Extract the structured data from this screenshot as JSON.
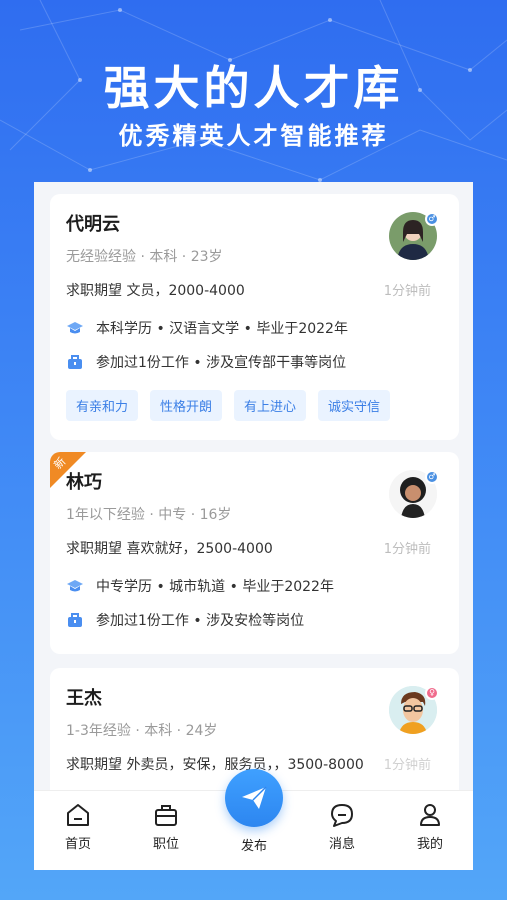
{
  "hero": {
    "title": "强大的人才库",
    "subtitle": "优秀精英人才智能推荐"
  },
  "colors": {
    "brand": "#2f6df0",
    "tag_bg": "#eaf3ff",
    "tag_text": "#3b7fe6",
    "new_badge": "#f08a24",
    "male": "#4a90e2",
    "female": "#f06b8c"
  },
  "candidates": [
    {
      "name": "代明云",
      "meta": "无经验经验 · 本科 · 23岁",
      "expect": "求职期望 文员，2000-4000",
      "time": "1分钟前",
      "education": "本科学历 • 汉语言文学 • 毕业于2022年",
      "work": "参加过1份工作 • 涉及宣传部干事等岗位",
      "tags": [
        "有亲和力",
        "性格开朗",
        "有上进心",
        "诚实守信"
      ],
      "gender": "male",
      "is_new": false
    },
    {
      "name": "林巧",
      "meta": "1年以下经验 · 中专 · 16岁",
      "expect": "求职期望 喜欢就好，2500-4000",
      "time": "1分钟前",
      "education": "中专学历 • 城市轨道 • 毕业于2022年",
      "work": "参加过1份工作 • 涉及安检等岗位",
      "gender": "male",
      "is_new": true,
      "new_label": "新"
    },
    {
      "name": "王杰",
      "meta": "1-3年经验 · 本科 · 24岁",
      "expect": "求职期望 外卖员，安保，服务员，，3500-8000",
      "time": "1分钟前",
      "gender": "female",
      "is_new": false
    }
  ],
  "tabbar": {
    "items": [
      {
        "label": "首页",
        "icon": "home-icon"
      },
      {
        "label": "职位",
        "icon": "briefcase-icon"
      },
      {
        "label": "发布",
        "icon": "paper-plane-icon"
      },
      {
        "label": "消息",
        "icon": "chat-icon"
      },
      {
        "label": "我的",
        "icon": "user-icon"
      }
    ]
  }
}
